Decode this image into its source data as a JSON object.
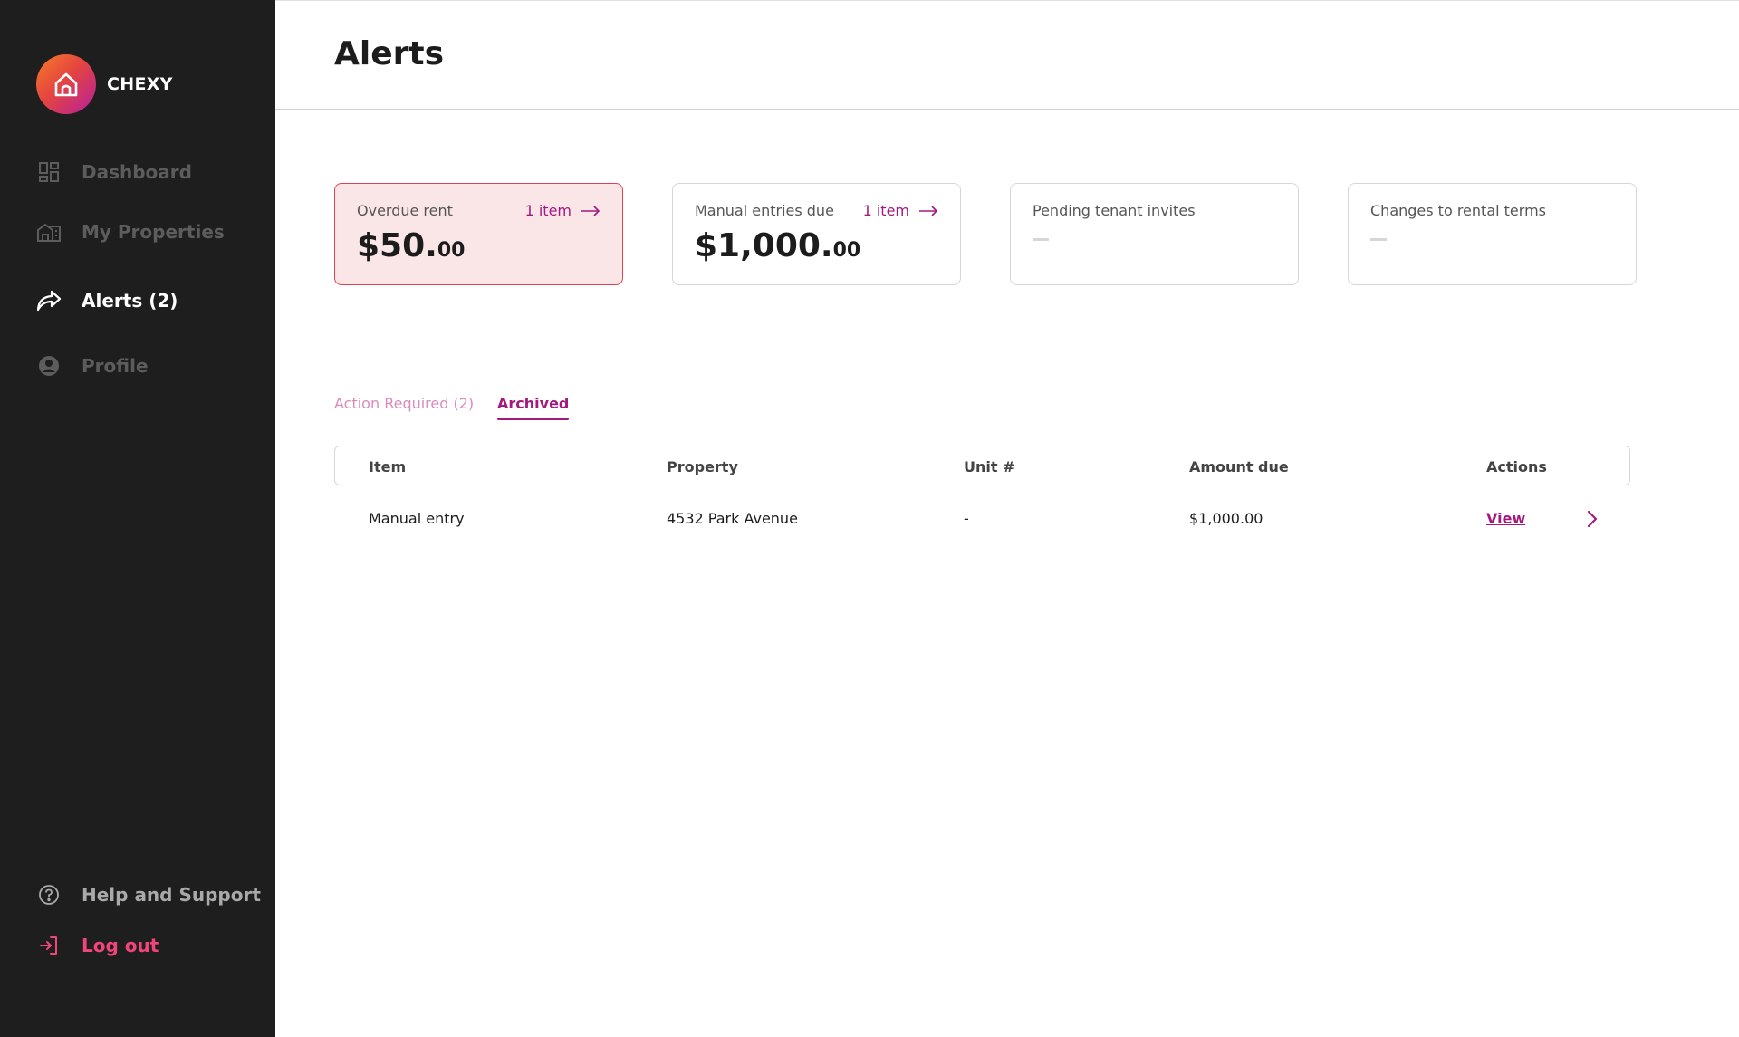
{
  "brand": {
    "name": "CHEXY"
  },
  "sidebar": {
    "items": [
      {
        "label": "Dashboard",
        "icon": "dashboard-icon"
      },
      {
        "label": "My Properties",
        "icon": "building-icon"
      },
      {
        "label": "Alerts (2)",
        "icon": "share-arrow-icon",
        "active": true
      },
      {
        "label": "Profile",
        "icon": "user-icon"
      }
    ],
    "help_label": "Help and Support",
    "logout_label": "Log out"
  },
  "header": {
    "title": "Alerts"
  },
  "cards": [
    {
      "label": "Overdue rent",
      "link": "1 item",
      "amount_main": "$50.",
      "amount_cents": "00",
      "status": "alert"
    },
    {
      "label": "Manual entries due",
      "link": "1 item",
      "amount_main": "$1,000.",
      "amount_cents": "00"
    },
    {
      "label": "Pending tenant invites"
    },
    {
      "label": "Changes to rental terms"
    }
  ],
  "tabs": [
    {
      "label": "Action Required (2)",
      "active": false
    },
    {
      "label": "Archived",
      "active": true
    }
  ],
  "table": {
    "columns": [
      "Item",
      "Property",
      "Unit #",
      "Amount due",
      "Actions"
    ],
    "rows": [
      {
        "item": "Manual entry",
        "property": "4532 Park Avenue",
        "unit": "-",
        "amount": "$1,000.00",
        "action": "View"
      }
    ]
  },
  "colors": {
    "sidebar_bg": "#1e1e1e",
    "accent": "#a3197f",
    "logout": "#f0457a",
    "alert_bg": "#fbe6e7",
    "alert_border": "#e0434f"
  }
}
